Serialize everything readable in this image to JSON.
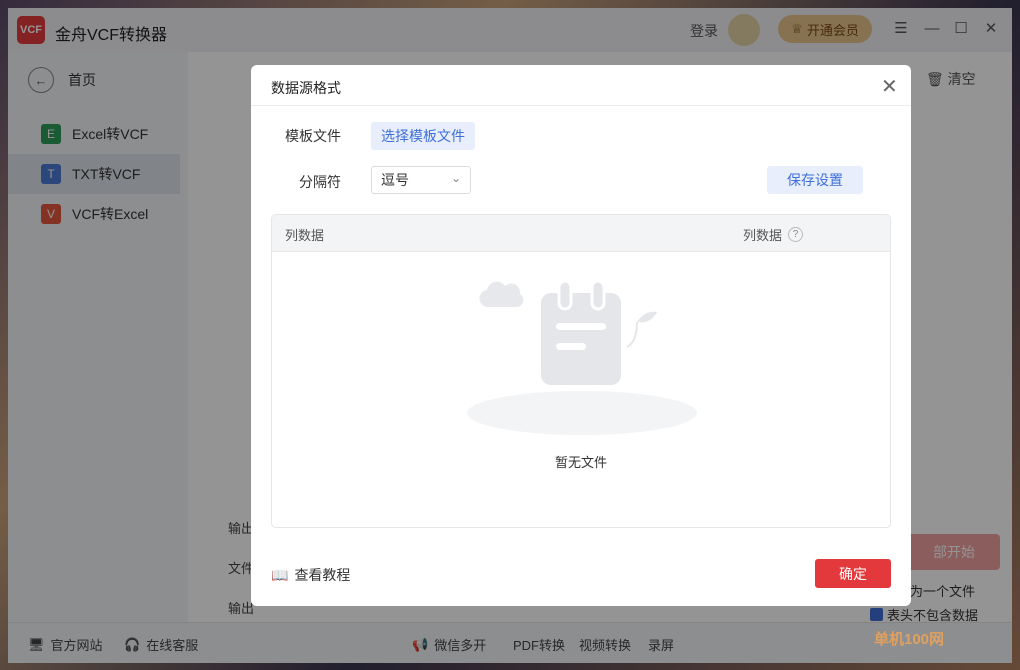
{
  "app": {
    "title": "金舟VCF转换器",
    "logo_text": "VCF",
    "login": "登录",
    "vip": "开通会员"
  },
  "sidebar": {
    "home": "首页",
    "items": [
      {
        "label": "Excel转VCF",
        "icon_letter": "E",
        "color": "#2f9e5b",
        "active": false
      },
      {
        "label": "TXT转VCF",
        "icon_letter": "T",
        "color": "#4a7bd6",
        "active": true
      },
      {
        "label": "VCF转Excel",
        "icon_letter": "V",
        "color": "#e4563e",
        "active": false
      }
    ]
  },
  "main": {
    "clear": "清空",
    "start": "部开始",
    "output1": "输出",
    "output2": "文件",
    "output3": "输出",
    "merge": "为一个文件",
    "exclude": "表头不包含数据"
  },
  "footer": {
    "website": "官方网站",
    "service": "在线客服",
    "wechat": "微信多开",
    "pdf": "PDF转换",
    "video": "视频转换",
    "record": "录屏"
  },
  "dialog": {
    "title": "数据源格式",
    "template_label": "模板文件",
    "template_button": "选择模板文件",
    "delimiter_label": "分隔符",
    "delimiter_value": "逗号",
    "save_button": "保存设置",
    "table_headers": [
      "列数据",
      "列数据"
    ],
    "empty_text": "暂无文件",
    "tutorial": "查看教程",
    "ok": "确定"
  },
  "watermark": "单机100网",
  "colors": {
    "accent": "#e4393c",
    "primary": "#3f6fd8"
  }
}
